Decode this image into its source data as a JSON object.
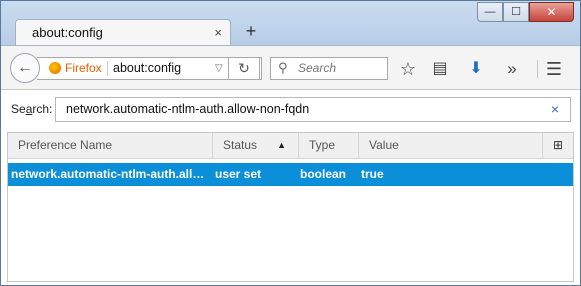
{
  "tab": {
    "title": "about:config",
    "close_glyph": "×",
    "new_tab_glyph": "+"
  },
  "window_controls": {
    "minimize": "—",
    "maximize": "☐",
    "close": "✕"
  },
  "navbar": {
    "back_glyph": "←",
    "identity_label": "Firefox",
    "url": "about:config",
    "url_dropdown_glyph": "▽",
    "reload_glyph": "↻",
    "search_placeholder": "Search",
    "search_glyph": "⚲",
    "icons": [
      "bookmark-star-icon",
      "reading-list-icon",
      "downloads-icon",
      "overflow-chevron-icon",
      "hamburger-menu-icon"
    ],
    "icon_glyphs": {
      "bookmark": "☆",
      "reading_list": "▤",
      "download": "⬇",
      "overflow": "»",
      "menu": "☰"
    }
  },
  "filter": {
    "label_prefix": "Se",
    "label_underlined": "a",
    "label_suffix": "rch:",
    "value": "network.automatic-ntlm-auth.allow-non-fqdn",
    "clear_glyph": "×"
  },
  "table": {
    "columns": {
      "name": "Preference Name",
      "status": "Status",
      "type": "Type",
      "value": "Value"
    },
    "sort_glyph": "▲",
    "picker_glyph": "⊞",
    "rows": [
      {
        "name": "network.automatic-ntlm-auth.allow-non-fqdn",
        "status": "user set",
        "type": "boolean",
        "value": "true"
      }
    ]
  },
  "colors": {
    "selection": "#0a8fd8",
    "identity": "#e66000",
    "download_icon": "#1a6fc4"
  }
}
